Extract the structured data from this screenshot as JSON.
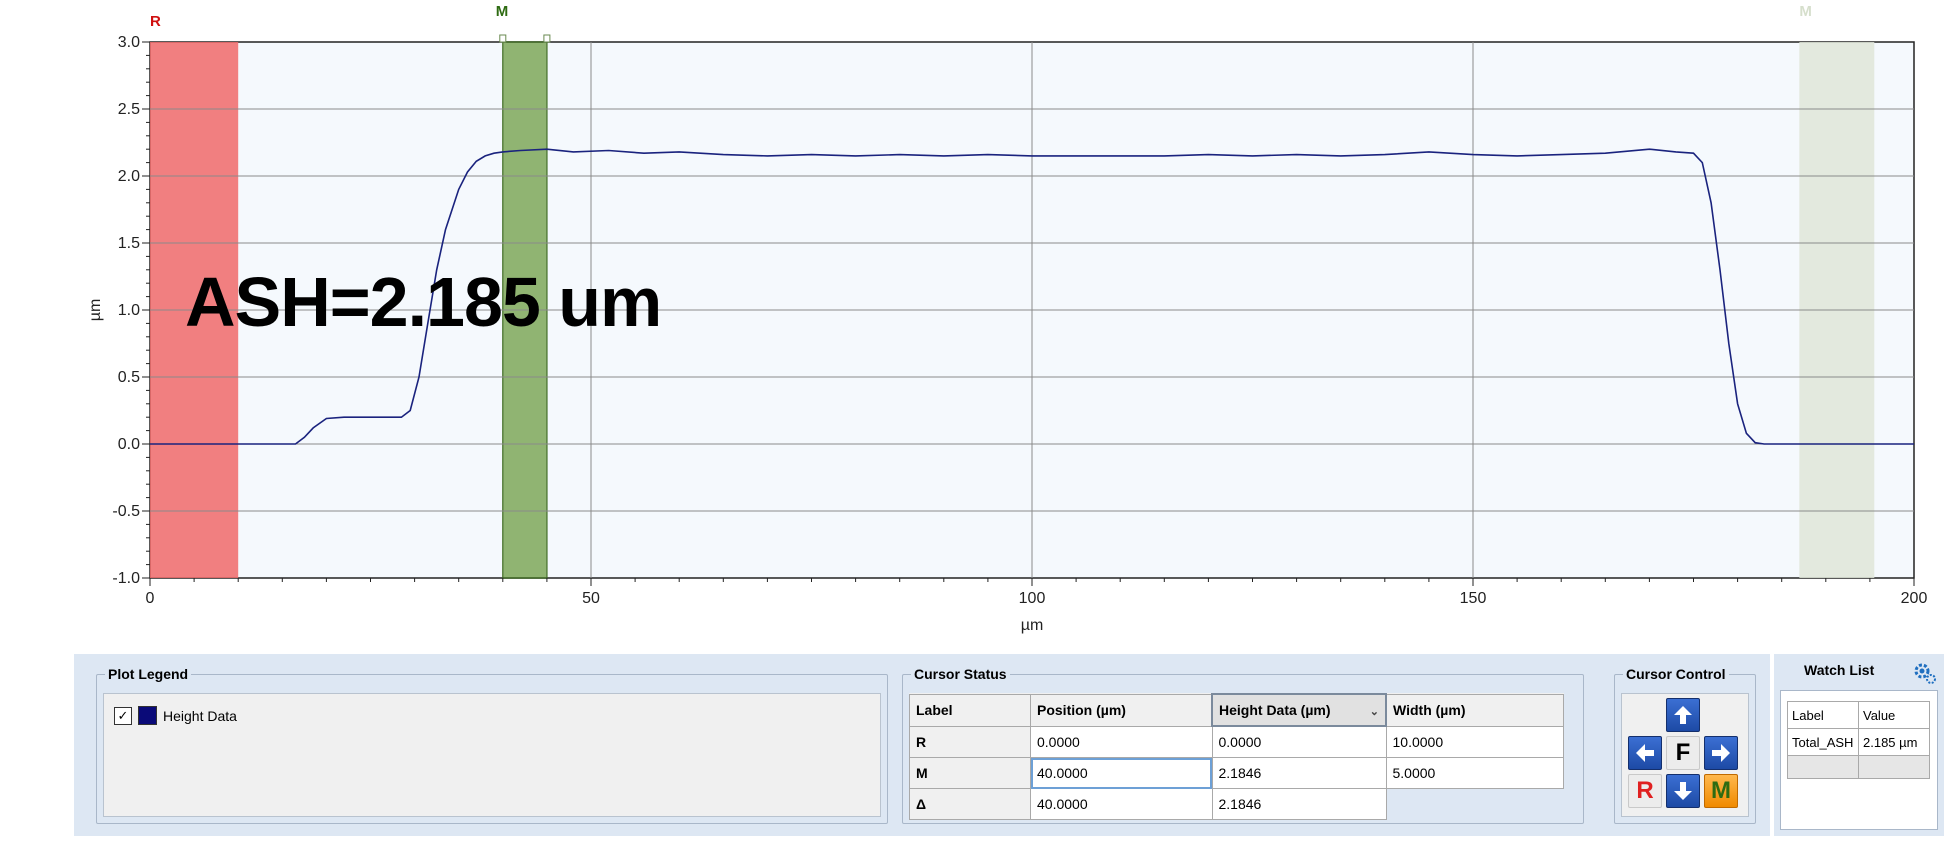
{
  "chart_data": {
    "type": "line",
    "xlabel": "µm",
    "ylabel": "µm",
    "xlim": [
      0,
      200
    ],
    "ylim": [
      -1.0,
      3.0
    ],
    "xticks": [
      0,
      50,
      100,
      150,
      200
    ],
    "yticks": [
      -1.0,
      -0.5,
      0.0,
      0.5,
      1.0,
      1.5,
      2.0,
      2.5,
      3.0
    ],
    "ytick_labels": [
      "-1.0",
      "-0.5",
      "0.0",
      "0.5",
      "1.0",
      "1.5",
      "2.0",
      "2.5",
      "3.0"
    ],
    "grid": true,
    "series": [
      {
        "name": "Height Data",
        "color": "#1a237e",
        "x": [
          0,
          2,
          5,
          8,
          10,
          13,
          15,
          16.5,
          17.5,
          18.5,
          20,
          22,
          25,
          27,
          28.5,
          29.5,
          30.5,
          31.5,
          32.5,
          33.5,
          35,
          36,
          37,
          38,
          39,
          40,
          42,
          45,
          48,
          52,
          56,
          60,
          65,
          70,
          75,
          80,
          85,
          90,
          95,
          100,
          105,
          110,
          115,
          120,
          125,
          130,
          135,
          140,
          145,
          150,
          155,
          160,
          165,
          170,
          173,
          175,
          176,
          177,
          178,
          179,
          180,
          181,
          182,
          183,
          185,
          188,
          190,
          193,
          195,
          198,
          200
        ],
        "y": [
          0.0,
          0.0,
          0.0,
          0.0,
          0.0,
          0.0,
          0.0,
          0.0,
          0.05,
          0.12,
          0.19,
          0.2,
          0.2,
          0.2,
          0.2,
          0.25,
          0.5,
          0.9,
          1.3,
          1.6,
          1.9,
          2.03,
          2.11,
          2.15,
          2.17,
          2.18,
          2.19,
          2.2,
          2.18,
          2.19,
          2.17,
          2.18,
          2.16,
          2.15,
          2.16,
          2.15,
          2.16,
          2.15,
          2.16,
          2.15,
          2.15,
          2.15,
          2.15,
          2.16,
          2.15,
          2.16,
          2.15,
          2.16,
          2.18,
          2.16,
          2.15,
          2.16,
          2.17,
          2.2,
          2.18,
          2.17,
          2.1,
          1.8,
          1.3,
          0.75,
          0.3,
          0.08,
          0.01,
          0.0,
          0.0,
          0.0,
          0.0,
          0.0,
          0.0,
          0.0,
          0.0
        ]
      }
    ],
    "cursors": [
      {
        "label": "R",
        "start": 0,
        "width": 10,
        "color": "#f06a6a"
      },
      {
        "label": "M",
        "start": 40,
        "width": 5,
        "color": "#7fa85a"
      },
      {
        "label": "M",
        "start": 187,
        "width": 8.5,
        "color": "#dfe6d8"
      }
    ],
    "annotation": "ASH=2.185 um"
  },
  "legend": {
    "title": "Plot Legend",
    "items": [
      {
        "label": "Height Data",
        "checked": true,
        "color": "#0a0a78"
      }
    ]
  },
  "cursor_status": {
    "title": "Cursor Status",
    "headers": [
      "Label",
      "Position (µm)",
      "Height Data (µm)",
      "Width (µm)"
    ],
    "rows": [
      {
        "label": "R",
        "position": "0.0000",
        "height": "0.0000",
        "width": "10.0000"
      },
      {
        "label": "M",
        "position": "40.0000",
        "height": "2.1846",
        "width": "5.0000"
      },
      {
        "label": "Δ",
        "position": "40.0000",
        "height": "2.1846",
        "width": ""
      }
    ]
  },
  "cursor_control": {
    "title": "Cursor Control",
    "up_icon": "arrow-up-icon",
    "down_icon": "arrow-down-icon",
    "left_icon": "arrow-left-icon",
    "right_icon": "arrow-right-icon",
    "f_label": "F",
    "r_label": "R",
    "m_label": "M"
  },
  "watch_list": {
    "title": "Watch List",
    "gear_icon": "gear-icon",
    "headers": [
      "Label",
      "Value"
    ],
    "rows": [
      {
        "label": "Total_ASH",
        "value": "2.185 µm"
      }
    ]
  }
}
